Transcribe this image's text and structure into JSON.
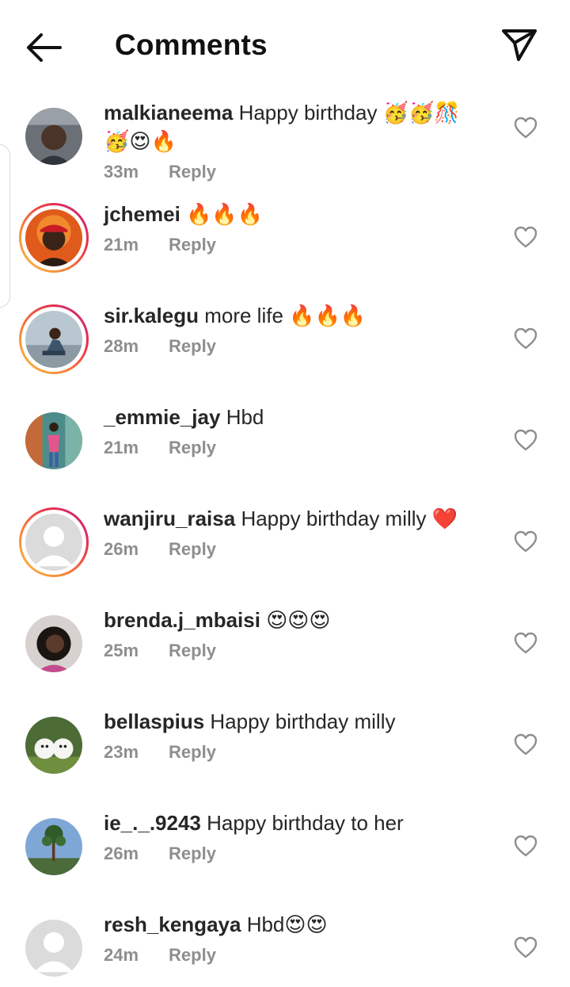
{
  "header": {
    "title": "Comments",
    "back_icon": "arrow-left-icon",
    "send_icon": "paper-plane-icon"
  },
  "comments": [
    {
      "username": "malkianeema",
      "text": "Happy birthday 🥳🥳🎊🥳😍🔥",
      "time": "33m",
      "reply": "Reply",
      "ring": false,
      "avatar": "photo-person"
    },
    {
      "username": "jchemei",
      "text": "🔥🔥🔥",
      "time": "21m",
      "reply": "Reply",
      "ring": true,
      "avatar": "photo-person-red-cap"
    },
    {
      "username": "sir.kalegu",
      "text": "more life 🔥🔥🔥",
      "time": "28m",
      "reply": "Reply",
      "ring": true,
      "avatar": "photo-person-sitting"
    },
    {
      "username": "_emmie_jay",
      "text": "Hbd",
      "time": "21m",
      "reply": "Reply",
      "ring": false,
      "avatar": "photo-person-standing"
    },
    {
      "username": "wanjiru_raisa",
      "text": "Happy birthday milly ❤️",
      "time": "26m",
      "reply": "Reply",
      "ring": true,
      "avatar": "default-avatar"
    },
    {
      "username": "brenda.j_mbaisi",
      "text": "😍😍😍",
      "time": "25m",
      "reply": "Reply",
      "ring": false,
      "avatar": "photo-person-dark"
    },
    {
      "username": "bellaspius",
      "text": "Happy birthday milly",
      "time": "23m",
      "reply": "Reply",
      "ring": false,
      "avatar": "photo-white-dogs"
    },
    {
      "username": "ie_._.9243",
      "text": "Happy birthday to her",
      "time": "26m",
      "reply": "Reply",
      "ring": false,
      "avatar": "photo-tree-landscape"
    },
    {
      "username": "resh_kengaya",
      "text": "Hbd😍😍",
      "time": "24m",
      "reply": "Reply",
      "ring": false,
      "avatar": "default-avatar"
    }
  ],
  "colors": {
    "text": "#262626",
    "muted": "#8e8e8e",
    "ring_start": "#f9c547",
    "ring_end": "#c2257e",
    "heart_outline": "#8e8e8e"
  }
}
